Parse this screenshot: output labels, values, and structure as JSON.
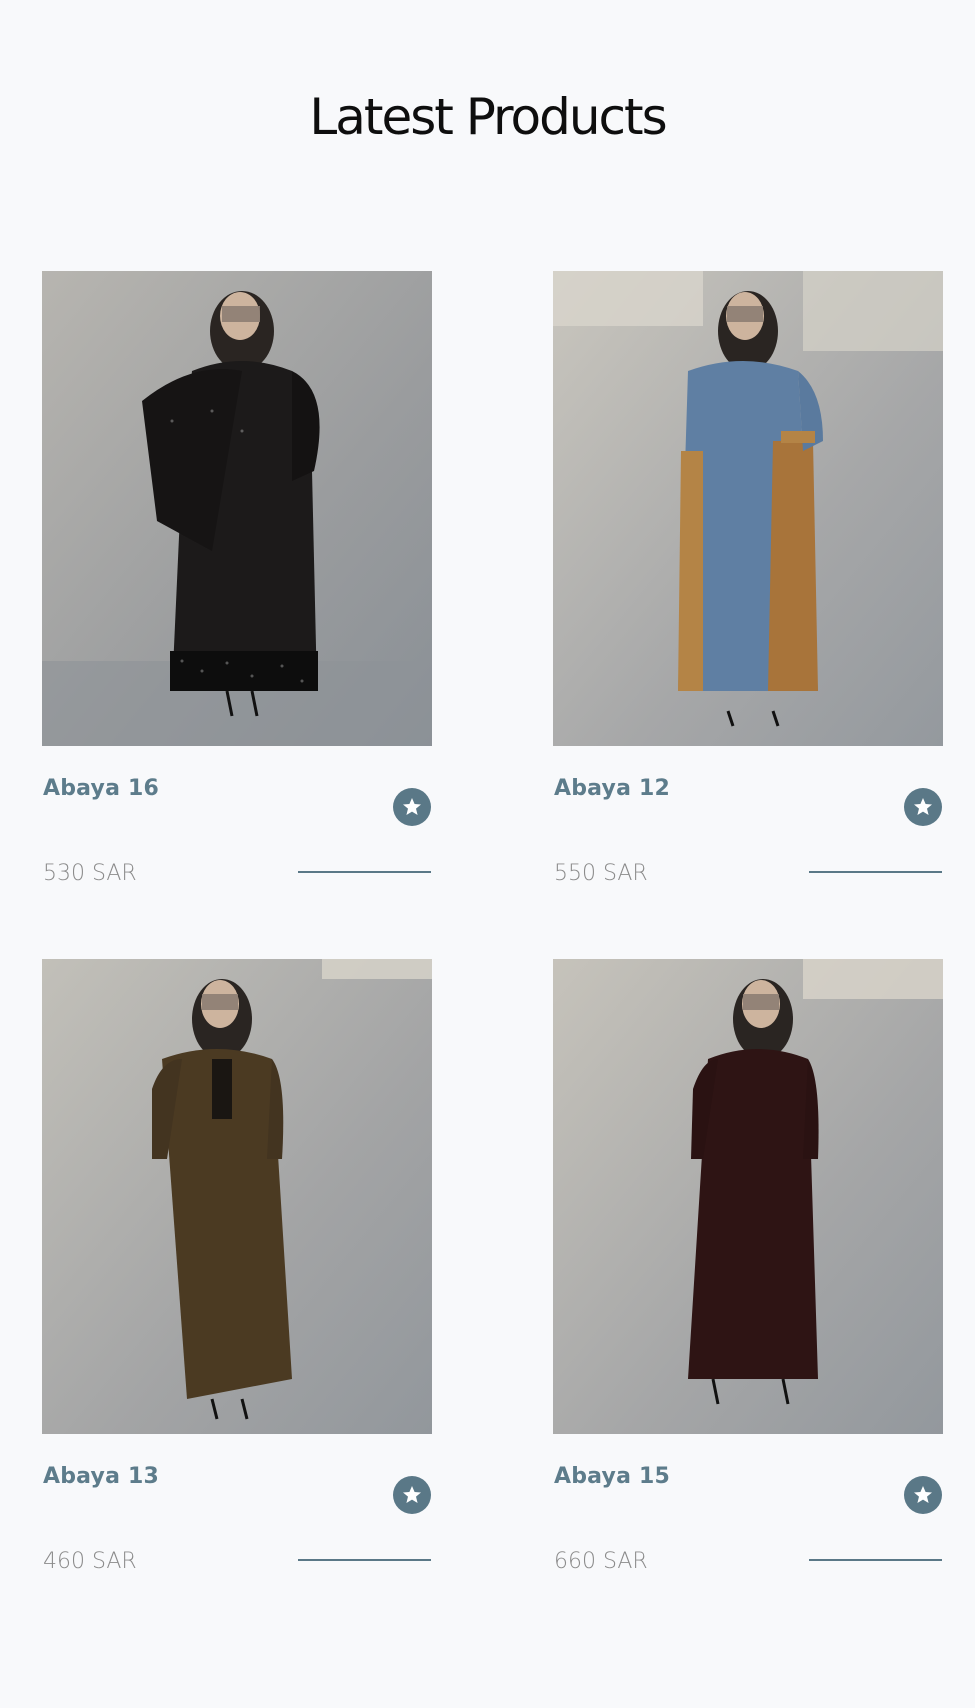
{
  "page": {
    "title": "Latest Products"
  },
  "colors": {
    "accent": "#5a7887",
    "name": "#5d7c8b",
    "price": "#8b8b8b",
    "background": "#f8f9fb"
  },
  "products": [
    {
      "name": "Abaya 16",
      "price": "530 SAR",
      "icon": "star-icon",
      "garment_color": "#1c1a1a"
    },
    {
      "name": "Abaya 12",
      "price": "550 SAR",
      "icon": "star-icon",
      "garment_color": "#5f7fa3"
    },
    {
      "name": "Abaya 13",
      "price": "460 SAR",
      "icon": "star-icon",
      "garment_color": "#4b3a22"
    },
    {
      "name": "Abaya 15",
      "price": "660 SAR",
      "icon": "star-icon",
      "garment_color": "#2e1414"
    }
  ]
}
